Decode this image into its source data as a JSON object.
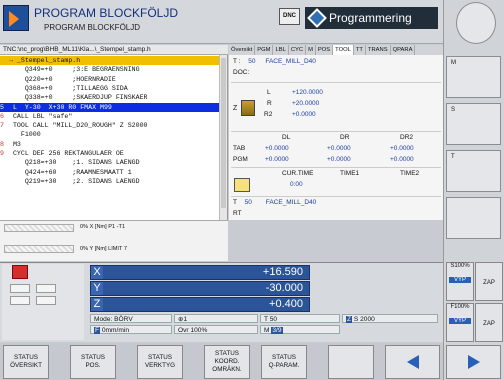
{
  "header": {
    "title": "PROGRAM BLOCKFÖLJD",
    "subtitle": "PROGRAM BLOCKFÖLJD",
    "dnc": "DNC",
    "program_tab": "Programmering"
  },
  "path": "TNC:\\nc_prog\\BHB_ML11\\Kla...\\_Stempel_stamp.h",
  "program": {
    "lines": [
      {
        "n": "",
        "text": "→ _Stempel_stamp.h",
        "cls": "cur"
      },
      {
        "n": "",
        "text": "    Q349=+0     ;3:E BEGRAENSNING",
        "cls": ""
      },
      {
        "n": "",
        "text": "    Q220=+0     ;HOERNRADIE",
        "cls": ""
      },
      {
        "n": "",
        "text": "    Q368=+0     ;TILLAEGG SIDA",
        "cls": ""
      },
      {
        "n": "",
        "text": "    Q338=+0     ;SKAERDJUP FINSKAER",
        "cls": ""
      },
      {
        "n": "5",
        "text": " L  Y-30  X+30 R0 FMAX M99",
        "cls": "sel"
      },
      {
        "n": "6",
        "text": " CALL LBL \"safe\"",
        "cls": ""
      },
      {
        "n": "7",
        "text": " TOOL CALL \"MILL_D20_ROUGH\" Z S2000",
        "cls": ""
      },
      {
        "n": "",
        "text": "   F1000",
        "cls": ""
      },
      {
        "n": "8",
        "text": " M3",
        "cls": ""
      },
      {
        "n": "9",
        "text": " CYCL DEF 256 REKTANGULAER OE",
        "cls": ""
      },
      {
        "n": "",
        "text": "    Q218=+30    ;1. SIDANS LAENGD",
        "cls": ""
      },
      {
        "n": "",
        "text": "    Q424=+60    ;RAAMNESMAATT 1",
        "cls": ""
      },
      {
        "n": "",
        "text": "    Q219=+30    ;2. SIDANS LAENGD",
        "cls": ""
      }
    ]
  },
  "status_tabs": [
    "Översikt",
    "PGM",
    "LBL",
    "CYC",
    "M",
    "POS",
    "TOOL",
    "TT",
    "TRANS",
    "QPARA"
  ],
  "tool": {
    "t_label": "T :",
    "t_num": "50",
    "t_name": "FACE_MILL_D40",
    "doc": "DOC:",
    "l_label": "L",
    "l_val": "+120.0000",
    "r_label": "R",
    "r_val": "+20.0000",
    "r2_label": "R2",
    "r2_val": "+0.0000",
    "z_label": "Z",
    "delta_headers": [
      "DL",
      "DR",
      "DR2"
    ],
    "tab_label": "TAB",
    "tab_vals": [
      "+0.0000",
      "+0.0000",
      "+0.0000"
    ],
    "pgm_label": "PGM",
    "pgm_vals": [
      "+0.0000",
      "+0.0000",
      "+0.0000"
    ],
    "time_headers": [
      "CUR.TIME",
      "TIME1",
      "TIME2"
    ],
    "cur_time": "0:00",
    "t2_label": "T",
    "t2_num": "50",
    "t2_name": "FACE_MILL_D40",
    "rt_label": "RT"
  },
  "limits": {
    "row1": "0% X [Nm]  P1  -T1",
    "row2": "0% Y [Nm]  LIMIT 7"
  },
  "axes": [
    {
      "label": "X",
      "value": "+16.590"
    },
    {
      "label": "Y",
      "value": "-30.000"
    },
    {
      "label": "Z",
      "value": "+0.400"
    }
  ],
  "info": {
    "mode": "Mode: BÖRV",
    "spindle": "⊕1",
    "t": "T 50",
    "s_label": "Z",
    "s": "S 2000",
    "feed_icon": "F",
    "feed": "0mm/min",
    "ovr": "Ovr 100%",
    "m": "M",
    "m_val": "3/9"
  },
  "softkeys": [
    {
      "l1": "STATUS",
      "l2": "ÖVERSIKT",
      "l3": ""
    },
    {
      "l1": "STATUS",
      "l2": "POS.",
      "l3": ""
    },
    {
      "l1": "STATUS",
      "l2": "VERKTYG",
      "l3": ""
    },
    {
      "l1": "STATUS",
      "l2": "KOORD.",
      "l3": "OMRÄKN."
    },
    {
      "l1": "STATUS",
      "l2": "Q-PARAM.",
      "l3": ""
    }
  ],
  "side": {
    "m": "M",
    "s": "S",
    "t": "T",
    "s100": "S100%",
    "f100": "F100%",
    "vyp": "VYP",
    "zap": "ZAP"
  }
}
